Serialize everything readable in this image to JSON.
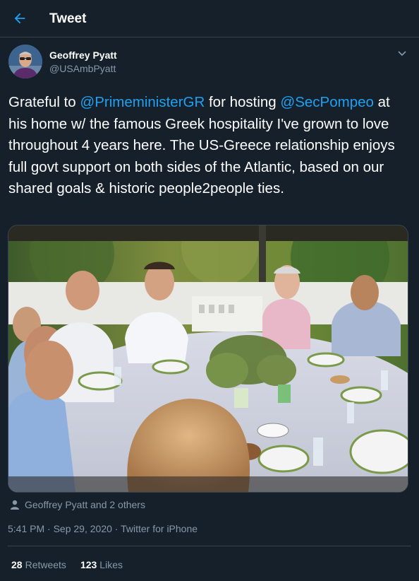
{
  "header": {
    "title": "Tweet",
    "back_icon": "arrow-left-icon",
    "accent": "#1da1f2"
  },
  "author": {
    "name": "Geoffrey Pyatt",
    "handle": "@USAmbPyatt",
    "menu_icon": "chevron-down-icon"
  },
  "tweet": {
    "text_before": "Grateful to ",
    "mention_1": "@PrimeministerGR",
    "text_middle": " for hosting ",
    "mention_2": "@SecPompeo",
    "text_after": " at his home w/ the famous Greek hospitality I've grown to love throughout 4 years here. The US-Greece relationship enjoys full govt support on both sides of the Atlantic, based on our shared goals & historic people2people ties."
  },
  "media": {
    "type": "photo",
    "subject": "outdoor dinner table scene"
  },
  "liked_by": {
    "text": "Geoffrey Pyatt and 2 others",
    "icon": "person-icon"
  },
  "meta": {
    "time": "5:41 PM",
    "separator_1": " · ",
    "date": "Sep 29, 2020",
    "separator_2": " · ",
    "source": "Twitter for iPhone"
  },
  "stats": {
    "retweets_count": "28",
    "retweets_label": "Retweets",
    "likes_count": "123",
    "likes_label": "Likes"
  },
  "colors": {
    "background": "#15202b",
    "border": "#38444d",
    "secondary_text": "#8899a6"
  }
}
